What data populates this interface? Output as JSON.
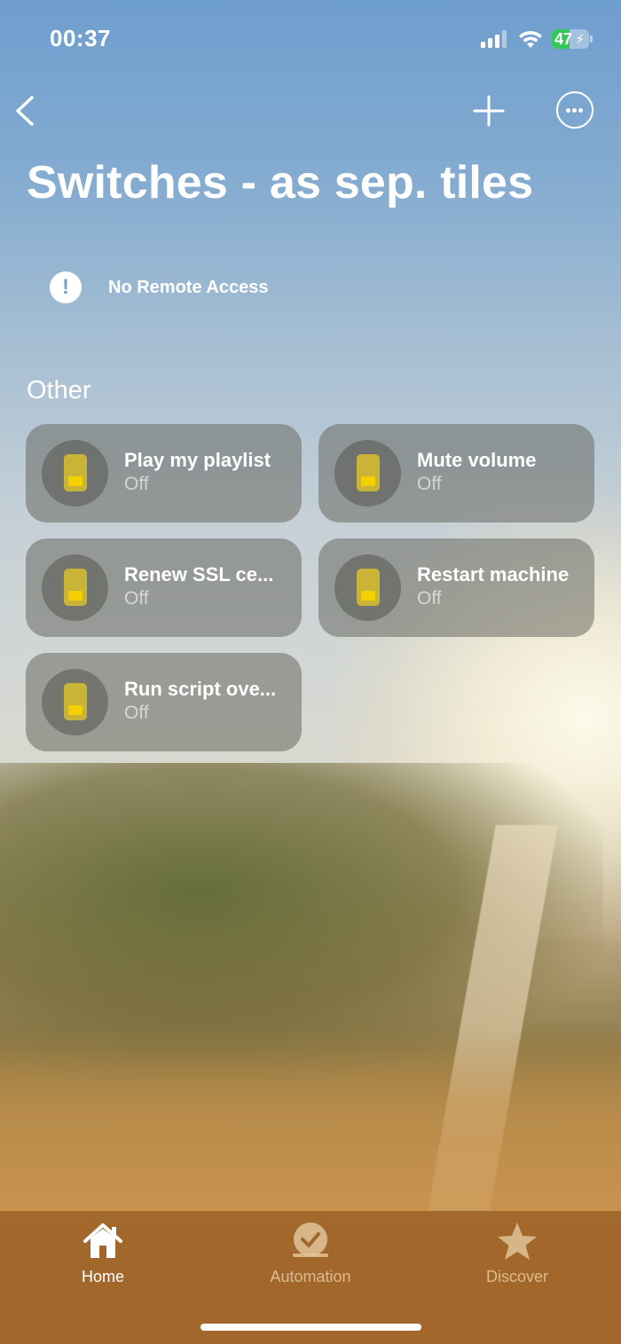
{
  "status_bar": {
    "time": "00:37",
    "battery_percent": "47",
    "battery_level": 0.47
  },
  "nav": {
    "back_icon": "chevron-left-icon",
    "add_icon": "plus-icon",
    "more_icon": "ellipsis-circle-icon"
  },
  "page": {
    "title": "Switches - as sep. tiles",
    "remote_access": {
      "icon": "exclamation-circle-icon",
      "label": "No Remote Access"
    },
    "section_title": "Other"
  },
  "tiles": [
    {
      "name": "Play my playlist",
      "state": "Off",
      "icon": "switch-icon"
    },
    {
      "name": "Mute volume",
      "state": "Off",
      "icon": "switch-icon"
    },
    {
      "name": "Renew SSL ce...",
      "state": "Off",
      "icon": "switch-icon"
    },
    {
      "name": "Restart machine",
      "state": "Off",
      "icon": "switch-icon"
    },
    {
      "name": "Run script ove...",
      "state": "Off",
      "icon": "switch-icon"
    }
  ],
  "tab_bar": {
    "items": [
      {
        "label": "Home",
        "icon": "house-icon",
        "selected": true
      },
      {
        "label": "Automation",
        "icon": "clock-check-icon",
        "selected": false
      },
      {
        "label": "Discover",
        "icon": "star-icon",
        "selected": false
      }
    ]
  },
  "colors": {
    "switch_body": "#c9b438",
    "switch_knob": "#f4d000",
    "battery_green": "#34c759",
    "tab_bar_bg": "#a0662a"
  }
}
